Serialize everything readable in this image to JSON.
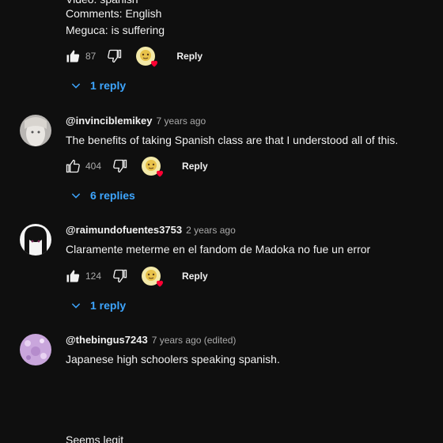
{
  "top_comment": {
    "partial_line": "Video: spanish",
    "line2": "Comments: English",
    "line3": "Meguca: is suffering",
    "likes": "87",
    "reply_label": "Reply",
    "replies_label": "1 reply"
  },
  "comments": [
    {
      "author": "@invinciblemikey",
      "time": "7 years ago",
      "text": "The benefits of taking Spanish class are that I understood all of this.",
      "likes": "404",
      "reply_label": "Reply",
      "replies_label": "6 replies"
    },
    {
      "author": "@raimundofuentes3753",
      "time": "2 years ago",
      "text": "Claramente meterme en el fandom de Madoka no fue un error",
      "likes": "124",
      "reply_label": "Reply",
      "replies_label": "1 reply"
    },
    {
      "author": "@thebingus7243",
      "time": "7 years ago (edited)",
      "text": "Japanese high schoolers speaking spanish.",
      "partial_line": "Seems legit"
    }
  ],
  "colors": {
    "background": "#0f0f0f",
    "text": "#f1f1f1",
    "meta": "#aaaaaa",
    "link_blue": "#3ea6ff",
    "heart_red": "#ff0033"
  }
}
